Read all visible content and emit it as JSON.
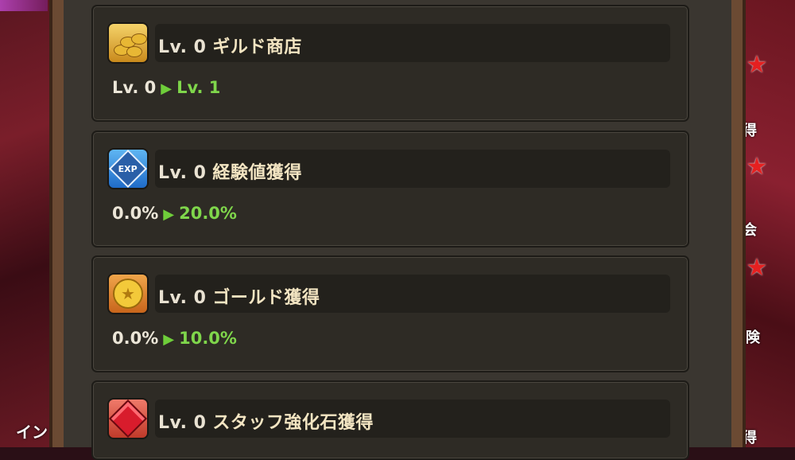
{
  "background": {
    "left_label": "イン",
    "right_labels": [
      "得",
      "会",
      "険",
      "得"
    ]
  },
  "cards": [
    {
      "icon": "gold-coins-icon",
      "title_level": "Lv. 0",
      "title": "ギルド商店",
      "from": "Lv. 0",
      "to": "Lv. 1"
    },
    {
      "icon": "exp-icon",
      "title_level": "Lv. 0",
      "title": "経験値獲得",
      "from": "0.0%",
      "to": "20.0%"
    },
    {
      "icon": "gold-coin-icon",
      "title_level": "Lv. 0",
      "title": "ゴールド獲得",
      "from": "0.0%",
      "to": "10.0%"
    },
    {
      "icon": "red-gem-icon",
      "title_level": "Lv. 0",
      "title": "スタッフ強化石獲得"
    }
  ],
  "arrow_glyph": "▶",
  "colors": {
    "increase": "#7fd64b",
    "title": "#f3e5c2"
  }
}
